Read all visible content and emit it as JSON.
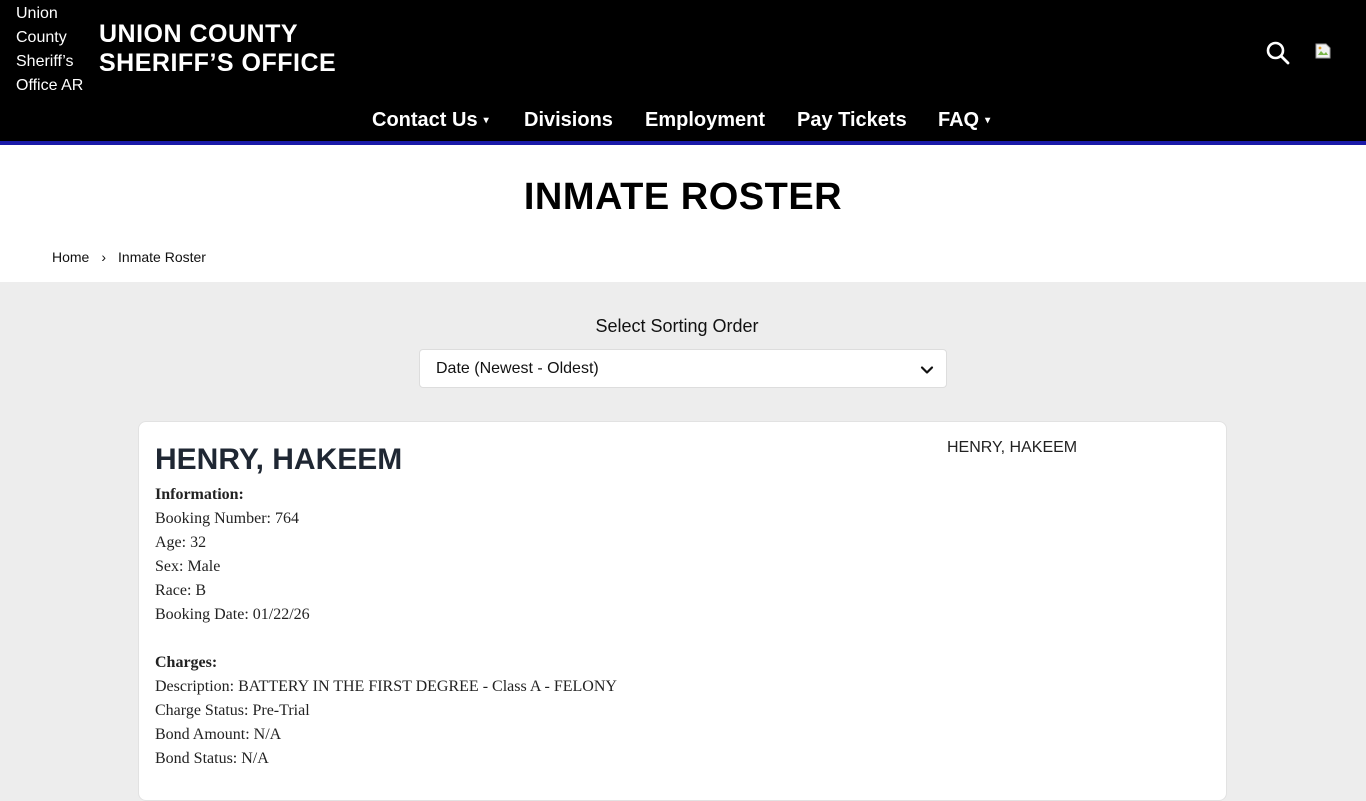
{
  "header": {
    "logo_alt": "Union County Sheriff’s Office AR",
    "site_title_line1": "UNION COUNTY",
    "site_title_line2": "SHERIFF’S OFFICE",
    "search_icon": "search-icon",
    "nav": [
      {
        "label": "Contact Us",
        "has_dropdown": true
      },
      {
        "label": "Divisions",
        "has_dropdown": false
      },
      {
        "label": "Employment",
        "has_dropdown": false
      },
      {
        "label": "Pay Tickets",
        "has_dropdown": false
      },
      {
        "label": "FAQ",
        "has_dropdown": true
      }
    ],
    "caret": "▾"
  },
  "page": {
    "title": "INMATE ROSTER",
    "breadcrumb": {
      "home": "Home",
      "separator": "›",
      "current": "Inmate Roster"
    }
  },
  "sort": {
    "label": "Select Sorting Order",
    "selected": "Date (Newest - Oldest)"
  },
  "inmate": {
    "name": "HENRY, HAKEEM",
    "photo_alt": "HENRY, HAKEEM",
    "info_heading": "Information:",
    "booking_number": "Booking Number: 764",
    "age": "Age: 32",
    "sex": "Sex: Male",
    "race": "Race: B",
    "booking_date": "Booking Date: 01/22/26",
    "charges_heading": "Charges:",
    "charge_description": "Description: BATTERY IN THE FIRST DEGREE - Class A - FELONY",
    "charge_status": "Charge Status: Pre-Trial",
    "bond_amount": "Bond Amount: N/A",
    "bond_status": "Bond Status: N/A"
  },
  "colors": {
    "header_bg": "#000000",
    "accent_bar": "#1a1aa8",
    "content_bg": "#ededed"
  }
}
